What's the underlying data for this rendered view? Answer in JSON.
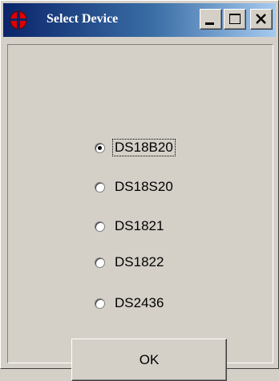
{
  "window": {
    "title": "Select Device",
    "icon": "red-chip-icon",
    "controls": {
      "minimize": "minimize-icon",
      "maximize": "maximize-icon",
      "close": "close-icon"
    }
  },
  "device_options": [
    {
      "label": "DS18B20",
      "selected": true
    },
    {
      "label": "DS18S20",
      "selected": false
    },
    {
      "label": "DS1821",
      "selected": false
    },
    {
      "label": "DS1822",
      "selected": false
    },
    {
      "label": "DS2436",
      "selected": false
    }
  ],
  "ok_button": {
    "label": "OK"
  },
  "colors": {
    "face": "#d4d0c8",
    "title_start": "#0a246a",
    "title_end": "#a6caf0",
    "icon_red": "#e00000"
  }
}
